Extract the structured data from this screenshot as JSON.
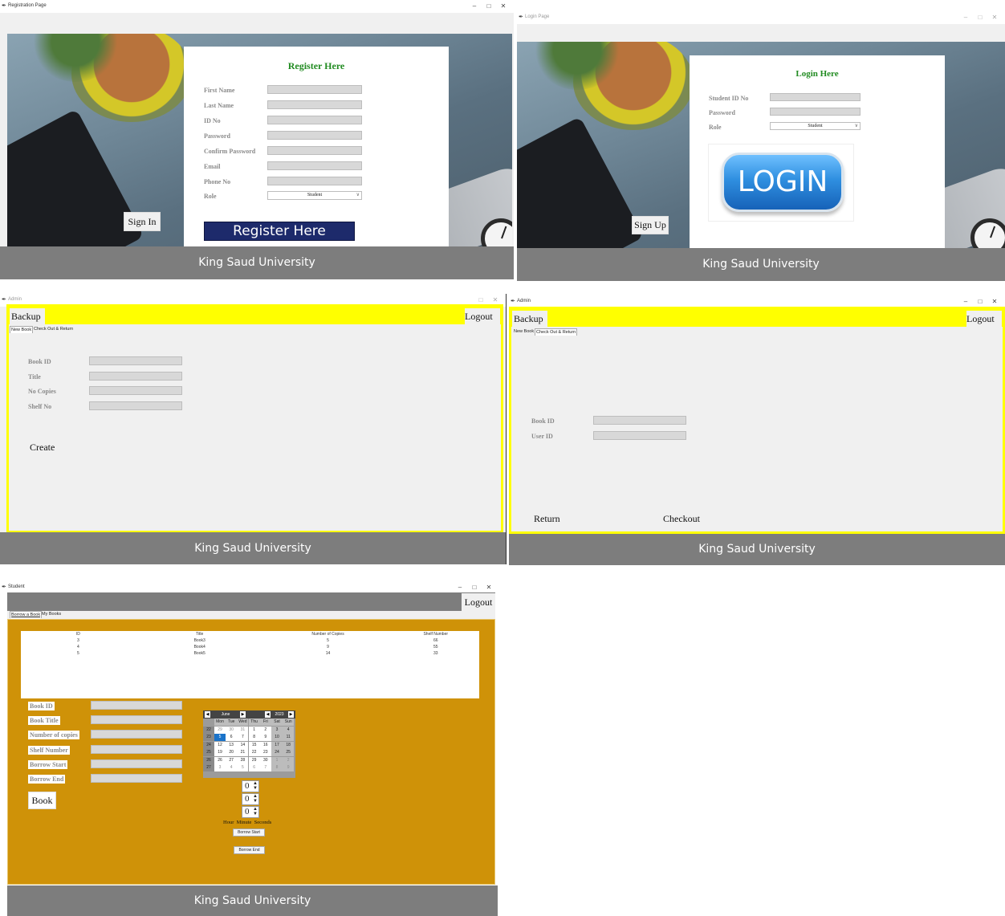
{
  "footer_text": "King Saud University",
  "registration": {
    "window_title": "Registration Page",
    "heading": "Register Here",
    "fields": [
      "First Name",
      "Last Name",
      "ID No",
      "Password",
      "Confirm Password",
      "Email",
      "Phone No"
    ],
    "role_label": "Role",
    "role_value": "Student",
    "sign_in_label": "Sign In",
    "register_button_label": "Register Here"
  },
  "login": {
    "window_title": "Login Page",
    "heading": "Login Here",
    "id_label": "Student ID No",
    "password_label": "Password",
    "role_label": "Role",
    "role_value": "Student",
    "login_button_label": "LOGIN",
    "sign_up_label": "Sign Up"
  },
  "admin_new": {
    "window_title": "Admin",
    "backup_label": "Backup",
    "logout_label": "Logout",
    "tabs": [
      "New Book",
      "Check Out & Return"
    ],
    "fields": [
      "Book ID",
      "Title",
      "No Copies",
      "Shelf No"
    ],
    "create_label": "Create"
  },
  "admin_checkout": {
    "window_title": "Admin",
    "backup_label": "Backup",
    "logout_label": "Logout",
    "tabs": [
      "New Book",
      "Check Out & Return"
    ],
    "fields": [
      "Book ID",
      "User ID"
    ],
    "return_label": "Return",
    "checkout_label": "Checkout"
  },
  "student": {
    "window_title": "Student",
    "logout_label": "Logout",
    "tabs": [
      "Borrow a Book",
      "My Books"
    ],
    "table": {
      "headers": [
        "ID",
        "Title",
        "Number of Copies",
        "Shelf Number"
      ],
      "rows": [
        [
          "3",
          "Book3",
          "5",
          "66"
        ],
        [
          "4",
          "Book4",
          "9",
          "55"
        ],
        [
          "5",
          "Book5",
          "14",
          "33"
        ]
      ]
    },
    "fields": [
      "Book ID",
      "Book Title",
      "Number of copies",
      "Shelf Number",
      "Borrow Start",
      "Borrow End"
    ],
    "book_button_label": "Book",
    "calendar": {
      "month": "June",
      "year": "2023",
      "weekdays": [
        "Mon",
        "Tue",
        "Wed",
        "Thu",
        "Fri",
        "Sat",
        "Sun"
      ],
      "weeks": [
        {
          "wk": "22",
          "days": [
            "29",
            "30",
            "31",
            "1",
            "2",
            "3",
            "4"
          ]
        },
        {
          "wk": "23",
          "days": [
            "5",
            "6",
            "7",
            "8",
            "9",
            "10",
            "11"
          ]
        },
        {
          "wk": "24",
          "days": [
            "12",
            "13",
            "14",
            "15",
            "16",
            "17",
            "18"
          ]
        },
        {
          "wk": "25",
          "days": [
            "19",
            "20",
            "21",
            "22",
            "23",
            "24",
            "25"
          ]
        },
        {
          "wk": "26",
          "days": [
            "26",
            "27",
            "28",
            "29",
            "30",
            "1",
            "2"
          ]
        },
        {
          "wk": "27",
          "days": [
            "3",
            "4",
            "5",
            "6",
            "7",
            "8",
            "9"
          ]
        }
      ],
      "selected_day": "5"
    },
    "spinbox_values": [
      "0",
      "0",
      "0"
    ],
    "time_labels": "Hour  Minute  Seconds",
    "borrow_start_button": "Borrow Start",
    "borrow_end_button": "Borrow End"
  },
  "colors": {
    "footer": "#7d7d7d",
    "heading_green": "#218b21",
    "admin_yellow": "#ffff00",
    "student_gold": "#cf9208",
    "register_navy": "#1d2a6b",
    "login_blue": "#2f8fe0"
  }
}
